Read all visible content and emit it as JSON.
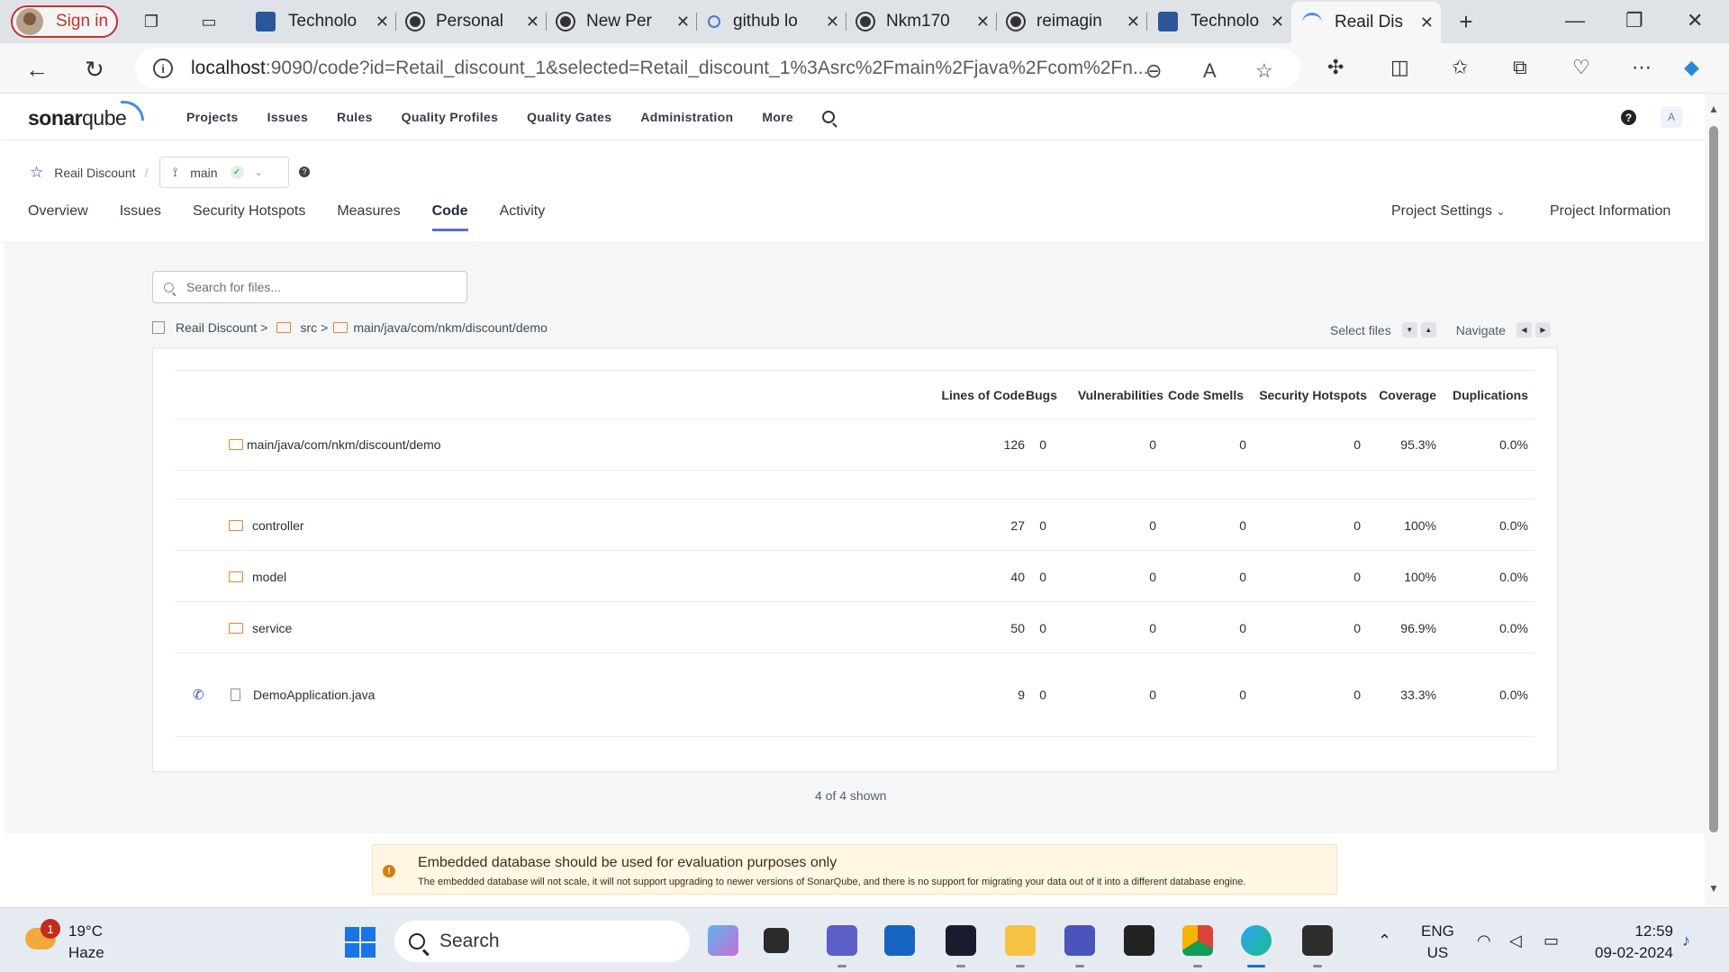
{
  "browser": {
    "signin_label": "Sign in",
    "tabs": [
      {
        "label": "Technolo",
        "icon": "word-icon"
      },
      {
        "label": "Personal",
        "icon": "github-icon"
      },
      {
        "label": "New Per",
        "icon": "github-icon"
      },
      {
        "label": "github lo",
        "icon": "search-icon"
      },
      {
        "label": "Nkm170",
        "icon": "github-icon"
      },
      {
        "label": "reimagin",
        "icon": "github-icon"
      },
      {
        "label": "Technolo",
        "icon": "word-icon"
      },
      {
        "label": "Reail Dis",
        "icon": "sonarqube-icon",
        "active": true
      }
    ],
    "url_host": "localhost",
    "url_rest": ":9090/code?id=Retail_discount_1&selected=Retail_discount_1%3Asrc%2Fmain%2Fjava%2Fcom%2Fn..."
  },
  "sonar": {
    "logo_bold": "sonar",
    "logo_light": "qube",
    "nav": [
      "Projects",
      "Issues",
      "Rules",
      "Quality Profiles",
      "Quality Gates",
      "Administration",
      "More"
    ],
    "user_initial": "A",
    "project_name": "Reail Discount",
    "branch": "main",
    "project_tabs": [
      "Overview",
      "Issues",
      "Security Hotspots",
      "Measures",
      "Code",
      "Activity"
    ],
    "active_tab": "Code",
    "project_settings": "Project Settings",
    "project_information": "Project Information"
  },
  "code": {
    "search_placeholder": "Search for files...",
    "breadcrumb": [
      "Reail Discount",
      "src",
      "main/java/com/nkm/discount/demo"
    ],
    "select_files": "Select files",
    "navigate": "Navigate",
    "columns": [
      "Lines of Code",
      "Bugs",
      "Vulnerabilities",
      "Code Smells",
      "Security Hotspots",
      "Coverage",
      "Duplications"
    ],
    "base_row": {
      "name": "main/java/com/nkm/discount/demo",
      "loc": "126",
      "bugs": "0",
      "vulns": "0",
      "smells": "0",
      "hotspots": "0",
      "coverage": "95.3%",
      "dup": "0.0%"
    },
    "rows": [
      {
        "name": "controller",
        "type": "dir",
        "loc": "27",
        "bugs": "0",
        "vulns": "0",
        "smells": "0",
        "hotspots": "0",
        "coverage": "100%",
        "dup": "0.0%"
      },
      {
        "name": "model",
        "type": "dir",
        "loc": "40",
        "bugs": "0",
        "vulns": "0",
        "smells": "0",
        "hotspots": "0",
        "coverage": "100%",
        "dup": "0.0%"
      },
      {
        "name": "service",
        "type": "dir",
        "loc": "50",
        "bugs": "0",
        "vulns": "0",
        "smells": "0",
        "hotspots": "0",
        "coverage": "96.9%",
        "dup": "0.0%"
      },
      {
        "name": "DemoApplication.java",
        "type": "file",
        "loc": "9",
        "bugs": "0",
        "vulns": "0",
        "smells": "0",
        "hotspots": "0",
        "coverage": "33.3%",
        "dup": "0.0%"
      }
    ],
    "shown": "4 of 4 shown"
  },
  "notice": {
    "title": "Embedded database should be used for evaluation purposes only",
    "body": "The embedded database will not scale, it will not support upgrading to newer versions of SonarQube, and there is no support for migrating your data out of it into a different database engine."
  },
  "taskbar": {
    "weather_badge": "1",
    "temperature": "19°C",
    "condition": "Haze",
    "search_label": "Search",
    "lang_line1": "ENG",
    "lang_line2": "US",
    "time": "12:59",
    "date": "09-02-2024"
  }
}
